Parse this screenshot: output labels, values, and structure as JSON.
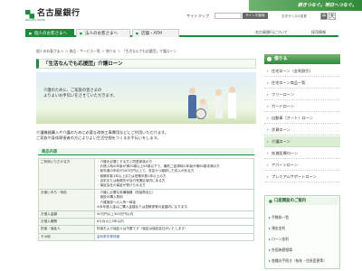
{
  "header": {
    "bank_name": "名古屋銀行",
    "logo_sub": "NAGOYA BANK",
    "banner_text": "耕きつなぐ。明日へつなぐ。",
    "sitemap": "サイトマップ",
    "search_button": "サイト内検索",
    "font_size_label": "文字サイズの変更",
    "font_mid": "中",
    "font_large": "大"
  },
  "nav": {
    "tabs": [
      "個人のお客さまへ",
      "法人のお客さまへ",
      "店舗・ATM"
    ],
    "right_links": [
      "名古屋銀行について",
      "採用情報"
    ]
  },
  "breadcrumb": "個人のお客さまへ ＞ 商品・サービス一覧 ＞ 借りる ＞ 「生活なんでも応援団」介護ローン",
  "page_title": "「生活なんでも応援団」介護ローン",
  "hero_copy": [
    "介護のために、ご家族の皆さまの",
    "よりよいお手伝いをさせていただきます。"
  ],
  "intro": [
    "介護機器購入や介護のために必要な改装工事費用などにご利用いただけます。",
    "ご家族や身体障害者の方によりよい生活空間をつくるお手伝いをします。"
  ],
  "section_title": "商品内容",
  "table": [
    {
      "label": "ご利用いただける方",
      "items": [
        "介護を必要とする方と同居家族の方",
        "お借入時の年齢が満20歳以上65歳以下で、最終ご返済時の年齢が満80歳未満の方",
        "前年度の年収が200万円以上で、安定かつ継続した収入がある方",
        "勤務年数1年以上または営業年数2年以上の方",
        "自宅または勤務先が当行営業区域内にある方",
        "保証会社の保証が受けられる方"
      ]
    },
    {
      "label": "お使いみち・特色",
      "items": [
        "介護に必要な設備機器（改装費含む）",
        "施設の購入費用",
        "介護施設への入所一時金"
      ],
      "note": "※本年度入金はご購入金額または見積書等の金額内になります。"
    },
    {
      "label": "お借入金額",
      "value": "50万円以上300万円以内"
    },
    {
      "label": "お借入期間",
      "value": "6カ月以上5年以内"
    },
    {
      "label": "担保・保証人",
      "value": "担保および保証人は不要です（保証は保証会社がいたします）"
    },
    {
      "label": "その他",
      "value": "金利条件等詳細"
    }
  ],
  "sidebar": {
    "borrow_heading": "借りる",
    "items": [
      "住宅ローン（金利割引）",
      "住宅ローン商品一覧",
      "フリーローン",
      "カードローン",
      "自動車（オート）ローン",
      "学資ローン",
      "介護ローン",
      "先進医療ローン",
      "アパートローン",
      "プレミアムサポートローン"
    ],
    "active_index": 6,
    "box_heading": "口座開設のご案内",
    "box_items": [
      "手数料一覧",
      "預金金利",
      "ローン金利",
      "外国為替相場",
      "各種お手続き（紛失・住所変更等）"
    ]
  },
  "colors": {
    "brand_green": "#1f8a3b",
    "light_green": "#eef5ec"
  }
}
